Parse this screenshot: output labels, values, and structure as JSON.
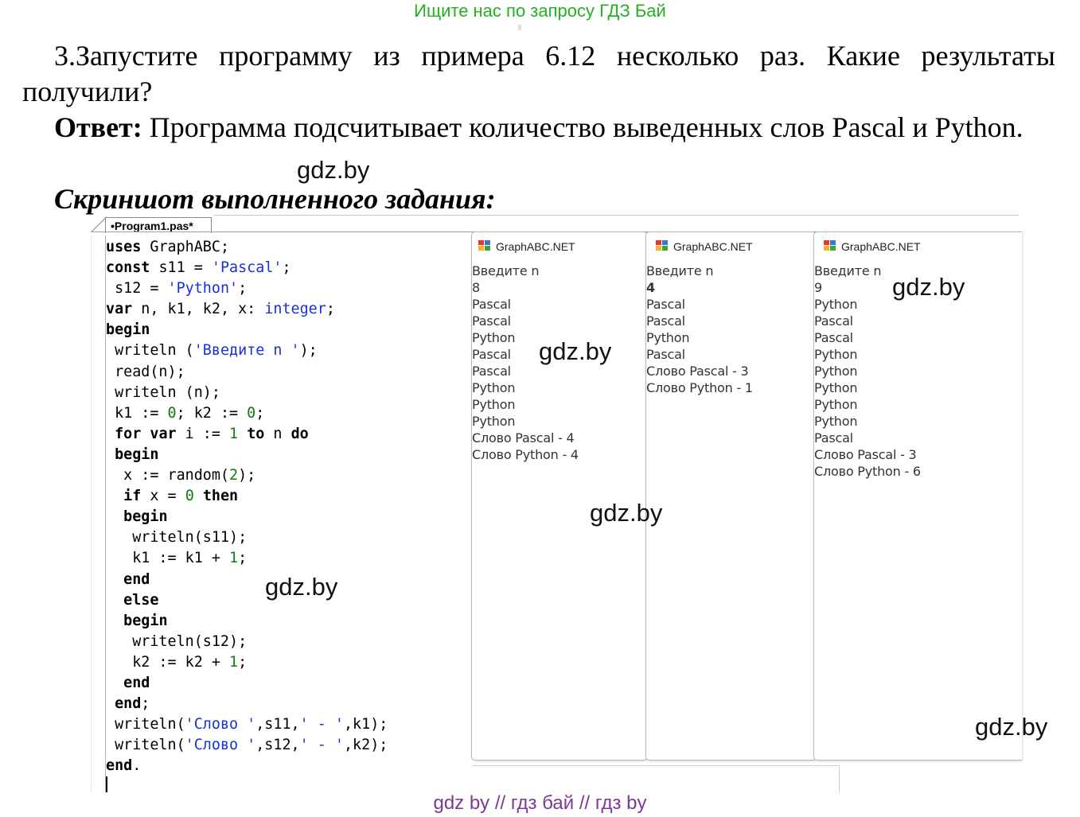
{
  "top_banner": "Ищите нас по запросу ГДЗ Бай",
  "question": "3.Запустите программу из примера 6.12 несколько раз. Какие результаты получили?",
  "answer_label": "Ответ:",
  "answer_text": " Программа подсчитывает количество выведенных слов Pascal и Python.",
  "screenshot_caption": "Скриншот выполненного задания:",
  "watermark": "gdz.by",
  "editor": {
    "tab_label": "•Program1.pas*"
  },
  "windows": [
    {
      "title": "GraphABC.NET",
      "lines": [
        "Введите n",
        "8",
        "Pascal",
        "Pascal",
        "Python",
        "Pascal",
        "Pascal",
        "Python",
        "Python",
        "Python",
        "Слово Pascal - 4",
        "Слово Python - 4"
      ]
    },
    {
      "title": "GraphABC.NET",
      "lines": [
        "Введите n",
        "4",
        "Pascal",
        "Pascal",
        "Python",
        "Pascal",
        "Слово Pascal - 3",
        "Слово Python - 1"
      ]
    },
    {
      "title": "GraphABC.NET",
      "lines": [
        "Введите n",
        "9",
        "Python",
        "Pascal",
        "Pascal",
        "Python",
        "Python",
        "Python",
        "Python",
        "Python",
        "Pascal",
        "Слово Pascal - 3",
        "Слово Python - 6"
      ]
    }
  ],
  "footer": "gdz by  //  гдз бай  //  гдз by"
}
